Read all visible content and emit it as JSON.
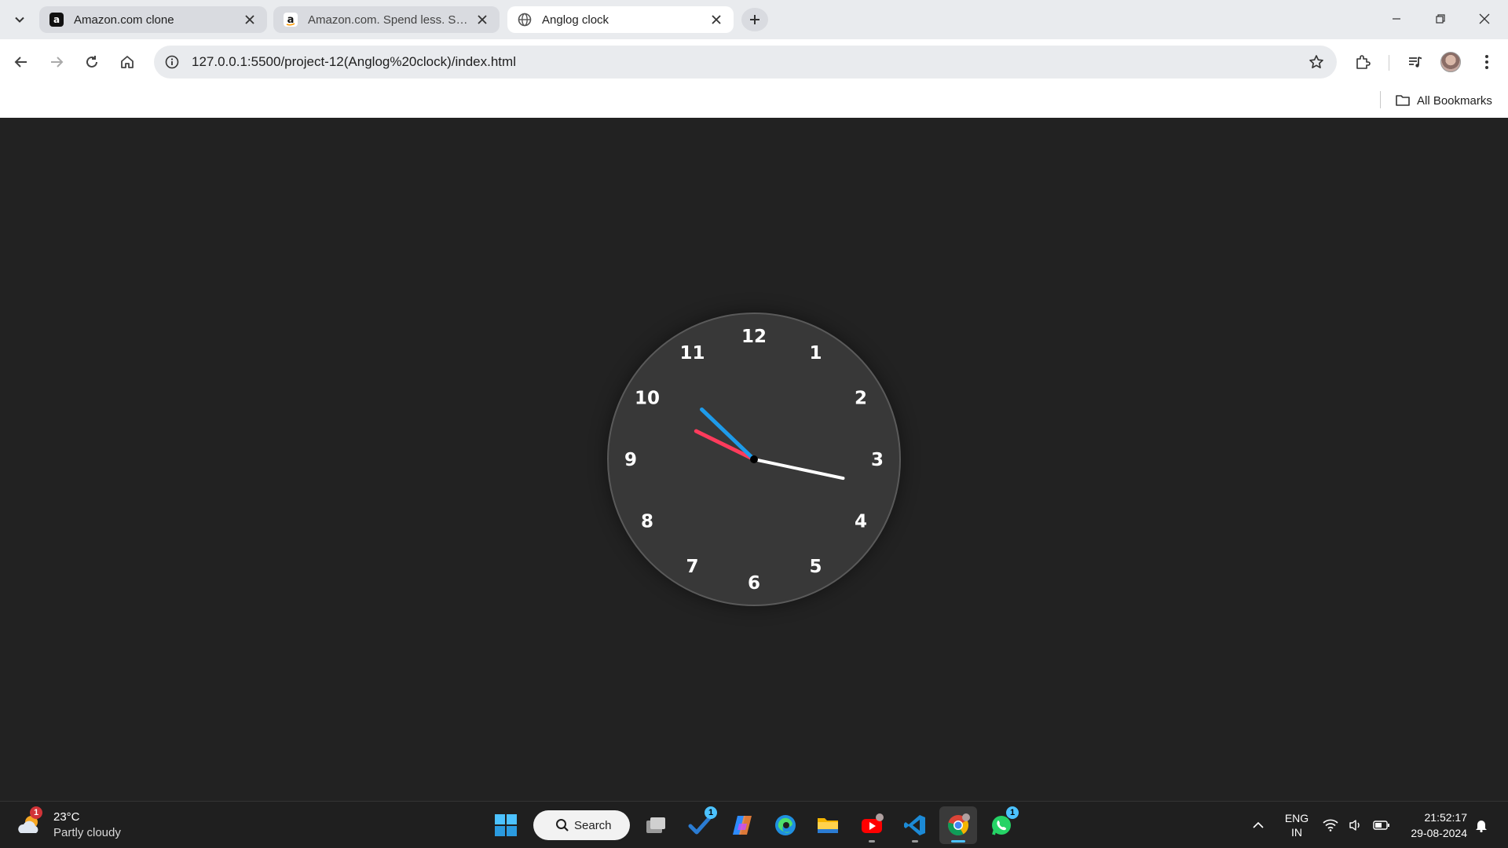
{
  "browser": {
    "tabs": [
      {
        "title": "Amazon.com clone",
        "favicon": "amazon-dark-icon",
        "active": false
      },
      {
        "title": "Amazon.com. Spend less. Smile",
        "favicon": "amazon-light-icon",
        "active": false
      },
      {
        "title": "Anglog clock",
        "favicon": "globe-icon",
        "active": true
      }
    ],
    "url": "127.0.0.1:5500/project-12(Anglog%20clock)/index.html",
    "bookmarks_label": "All Bookmarks"
  },
  "clock": {
    "numbers": [
      "12",
      "1",
      "2",
      "3",
      "4",
      "5",
      "6",
      "7",
      "8",
      "9",
      "10",
      "11"
    ],
    "time": {
      "hours": 21,
      "minutes": 52,
      "seconds": 17
    },
    "colors": {
      "face": "#383838",
      "hour_hand": "#ff3b5c",
      "minute_hand": "#1e9bea",
      "second_hand": "#ffffff",
      "center": "#000000"
    }
  },
  "taskbar": {
    "weather": {
      "temp": "23°C",
      "condition": "Partly cloudy",
      "badge": "1"
    },
    "search_label": "Search",
    "apps": [
      {
        "name": "task-view-icon",
        "badge": ""
      },
      {
        "name": "todo-icon",
        "badge": "1"
      },
      {
        "name": "copilot-icon",
        "badge": ""
      },
      {
        "name": "edge-icon",
        "badge": ""
      },
      {
        "name": "file-explorer-icon",
        "badge": ""
      },
      {
        "name": "youtube-icon",
        "badge": ""
      },
      {
        "name": "vscode-icon",
        "badge": ""
      },
      {
        "name": "chrome-icon",
        "badge": ""
      },
      {
        "name": "whatsapp-icon",
        "badge": "1"
      }
    ],
    "language": {
      "line1": "ENG",
      "line2": "IN"
    },
    "clock": {
      "time": "21:52:17",
      "date": "29-08-2024"
    }
  }
}
